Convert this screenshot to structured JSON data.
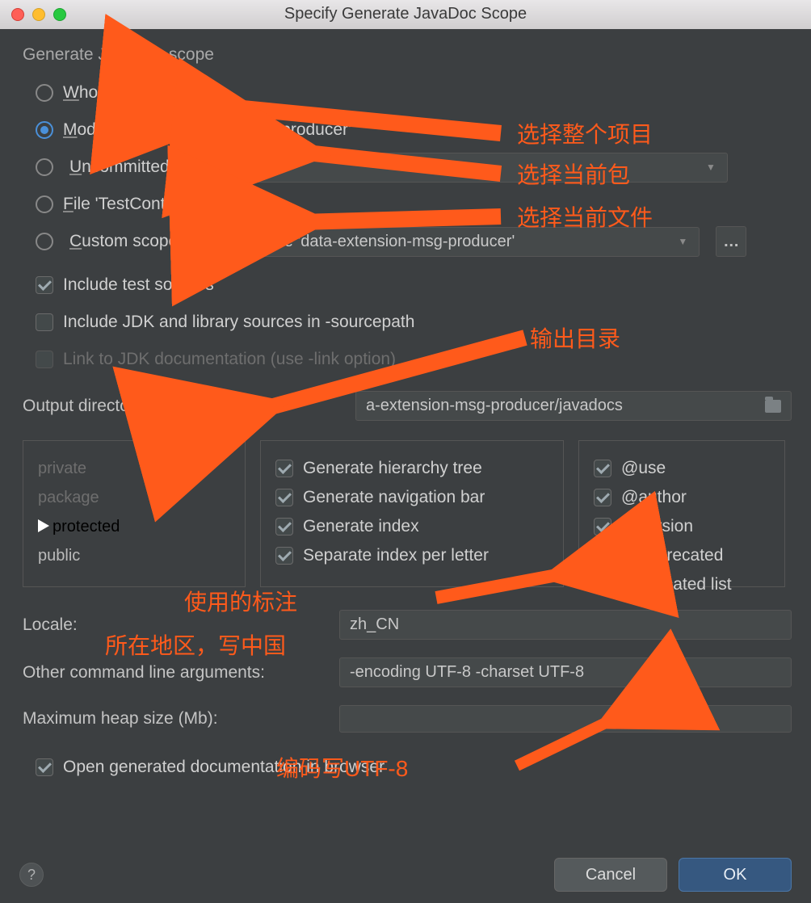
{
  "title": "Specify Generate JavaDoc Scope",
  "section": "Generate JavaDoc scope",
  "scope": {
    "whole_project": "Whole project",
    "module": "Module 'data-extension-msg-producer'",
    "uncommitted": "Uncommitted files",
    "uncommitted_sel": "All",
    "file": "File 'TestController.java'",
    "custom": "Custom scope",
    "custom_sel": "Module 'data-extension-msg-producer'"
  },
  "include_test": "Include test sources",
  "include_jdk": "Include JDK and library sources in -sourcepath",
  "link_jdk": "Link to JDK documentation (use -link option)",
  "out_dir_lbl": "Output directory:",
  "out_dir_val": "a-extension-msg-producer/javadocs",
  "visibility": {
    "private": "private",
    "package": "package",
    "protected": "protected",
    "public": "public"
  },
  "gen": {
    "tree": "Generate hierarchy tree",
    "nav": "Generate navigation bar",
    "index": "Generate index",
    "sep": "Separate index per letter"
  },
  "tags": {
    "use": "@use",
    "author": "@author",
    "version": "@version",
    "deprecated": "@deprecated",
    "dlist": "deprecated list"
  },
  "locale_lbl": "Locale:",
  "locale_val": "zh_CN",
  "args_lbl": "Other command line arguments:",
  "args_val": "-encoding UTF-8 -charset UTF-8",
  "heap_lbl": "Maximum heap size (Mb):",
  "open_doc": "Open generated documentation in browser",
  "cancel": "Cancel",
  "ok": "OK",
  "annotations": {
    "a1": "选择整个项目",
    "a2": "选择当前包",
    "a3": "选择当前文件",
    "a4": "输出目录",
    "a5": "使用的标注",
    "a6": "所在地区，写中国",
    "a7": "编码写UTF-8"
  }
}
